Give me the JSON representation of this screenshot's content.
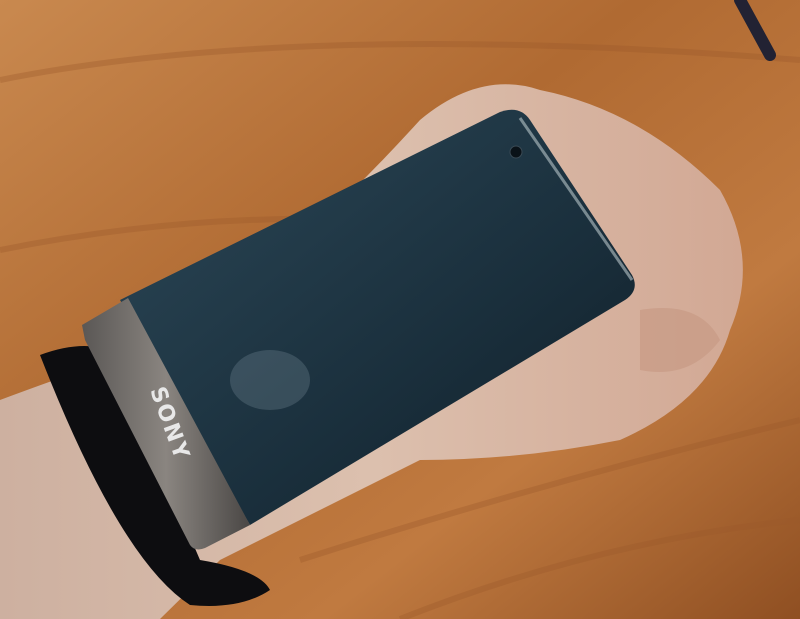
{
  "photo": {
    "subject": "phone-on-wrist",
    "phone_logo": "SONY",
    "colors": {
      "wood": "#b8733a",
      "wood_dark": "#8a4e22",
      "skin": "#d9b9a6",
      "phone_screen": "#1d3340",
      "phone_band": "#7a7672",
      "wristband": "#0d0d10"
    }
  }
}
